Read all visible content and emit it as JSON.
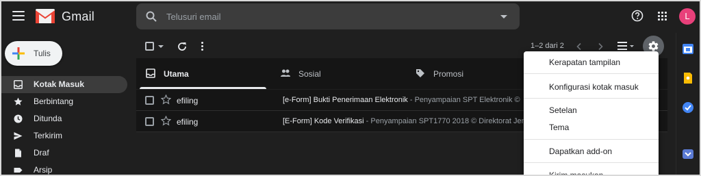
{
  "header": {
    "logo_text": "Gmail",
    "search_placeholder": "Telusuri email",
    "avatar_letter": "L"
  },
  "sidebar": {
    "compose_label": "Tulis",
    "items": [
      {
        "label": "Kotak Masuk",
        "icon": "inbox-icon",
        "active": true
      },
      {
        "label": "Berbintang",
        "icon": "star-icon"
      },
      {
        "label": "Ditunda",
        "icon": "clock-icon"
      },
      {
        "label": "Terkirim",
        "icon": "send-icon"
      },
      {
        "label": "Draf",
        "icon": "draft-icon"
      },
      {
        "label": "Arsip",
        "icon": "label-icon"
      }
    ]
  },
  "toolbar": {
    "pagination": "1–2 dari 2"
  },
  "tabs": [
    {
      "label": "Utama",
      "icon": "inbox-icon",
      "active": true
    },
    {
      "label": "Sosial",
      "icon": "people-icon"
    },
    {
      "label": "Promosi",
      "icon": "tag-icon"
    }
  ],
  "emails": [
    {
      "sender": "efiling",
      "subject": "[e-Form] Bukti Penerimaan Elektronik",
      "preview": " - Penyampaian SPT Elektronik ©"
    },
    {
      "sender": "efiling",
      "subject": "[E-Form] Kode Verifikasi",
      "preview": " - Penyampaian SPT1770 2018 © Direktorat Jen"
    }
  ],
  "settings_menu": {
    "items": [
      "Kerapatan tampilan",
      "Konfigurasi kotak masuk",
      "Setelan",
      "Tema",
      "Dapatkan add-on",
      "Kirim masukan"
    ]
  },
  "colors": {
    "background": "#1f1f1f",
    "avatar": "#e8407a",
    "gmail_red": "#ea4335"
  }
}
